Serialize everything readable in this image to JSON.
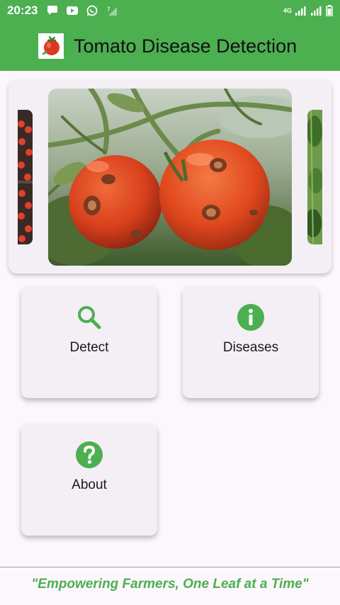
{
  "status_bar": {
    "time": "20:23",
    "network": "4G",
    "icons": [
      "chat-bubble-icon",
      "youtube-icon",
      "whatsapp-icon",
      "signal-unknown-icon",
      "signal-icon",
      "battery-icon"
    ]
  },
  "app_bar": {
    "title": "Tomato Disease Detection",
    "logo": "tomato-logo"
  },
  "carousel": {
    "slides": [
      "tomatoes-crates",
      "diseased-tomatoes-on-vine",
      "tomato-plant-leaves"
    ]
  },
  "tiles": [
    {
      "label": "Detect",
      "icon": "search-icon"
    },
    {
      "label": "Diseases",
      "icon": "info-icon"
    },
    {
      "label": "About",
      "icon": "help-icon"
    }
  ],
  "footer": {
    "quote": "\"Empowering Farmers, One Leaf at a Time\""
  },
  "colors": {
    "primary": "#4caf50",
    "background": "#fcf7fc",
    "card": "#f3eff4"
  }
}
